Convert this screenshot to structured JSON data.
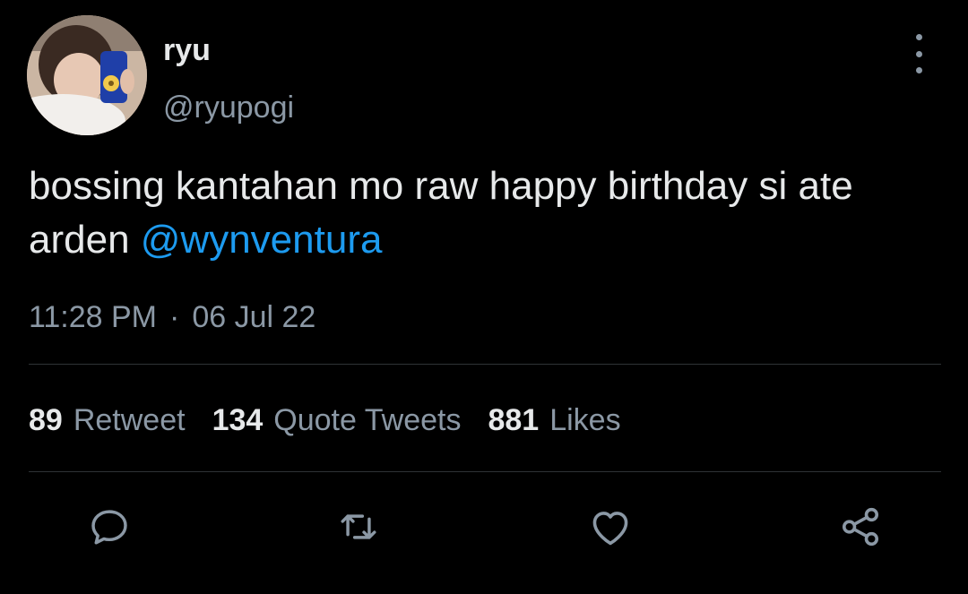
{
  "author": {
    "display_name": "ryu",
    "handle": "@ryupogi"
  },
  "tweet": {
    "text": "bossing kantahan mo raw happy birthday si ate arden ",
    "mention": "@wynventura",
    "time": "11:28 PM",
    "separator": "·",
    "date": "06 Jul 22"
  },
  "stats": {
    "retweets": {
      "count": "89",
      "label": "Retweet"
    },
    "quotes": {
      "count": "134",
      "label": "Quote Tweets"
    },
    "likes": {
      "count": "881",
      "label": "Likes"
    }
  },
  "icons": {
    "more": "more-vertical-icon",
    "reply": "reply-icon",
    "retweet": "retweet-icon",
    "like": "heart-icon",
    "share": "share-icon"
  },
  "colors": {
    "background": "#000000",
    "text": "#e7e9ea",
    "secondary": "#8b98a5",
    "accent": "#1d9bf0",
    "divider": "#2f3336"
  }
}
